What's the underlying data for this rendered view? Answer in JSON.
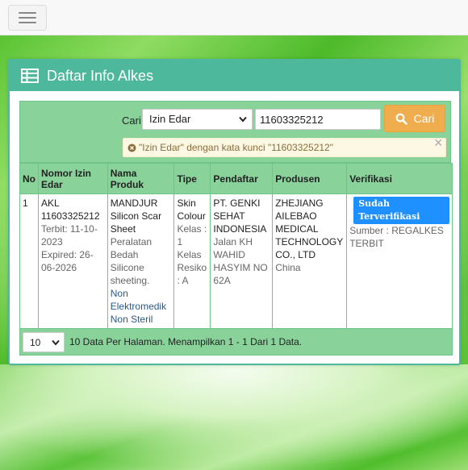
{
  "panel": {
    "title": "Daftar Info Alkes"
  },
  "search": {
    "label": "Cari",
    "field_selected": "Izin Edar",
    "query_value": "11603325212",
    "button_label": "Cari",
    "alert_text": "\"Izin Edar\" dengan kata kunci \"11603325212\"",
    "alert_close": "×"
  },
  "table": {
    "headers": {
      "no": "No",
      "nomor_izin": "Nomor Izin Edar",
      "nama_produk": "Nama Produk",
      "tipe": "Tipe",
      "pendaftar": "Pendaftar",
      "produsen": "Produsen",
      "verifikasi": "Verifikasi"
    },
    "rows": [
      {
        "no": "1",
        "izin_edar": "AKL 11603325212",
        "terbit": "Terbit: 11-10-2023",
        "expired": "Expired: 26-06-2026",
        "produk_nama": "MANDJUR Silicon Scar Sheet",
        "produk_jenis": "Peralatan Bedah Silicone sheeting.",
        "produk_kategori": "Non Elektromedik Non Steril",
        "tipe_nama": "Skin Colour",
        "tipe_kelas": "Kelas : 1",
        "tipe_resiko": "Kelas Resiko : A",
        "pendaftar_nama": "PT. GENKI SEHAT INDONESIA",
        "pendaftar_alamat": "Jalan KH WAHID HASYIM NO 62A",
        "produsen_nama": "ZHEJIANG AILEBAO MEDICAL TECHNOLOGY CO., LTD",
        "produsen_negara": "China",
        "verifikasi_badge": "Sudah Terverifikasi",
        "verifikasi_sumber": "Sumber : REGALKES TERBIT"
      }
    ]
  },
  "footer": {
    "per_page": "10",
    "info": "10 Data Per Halaman. Menampilkan 1 - 1 Dari 1 Data."
  },
  "colors": {
    "panel_accent": "#4db89b",
    "table_green": "#89d39b",
    "search_button": "#f0ad4e",
    "verified_badge": "#1e90ff"
  }
}
